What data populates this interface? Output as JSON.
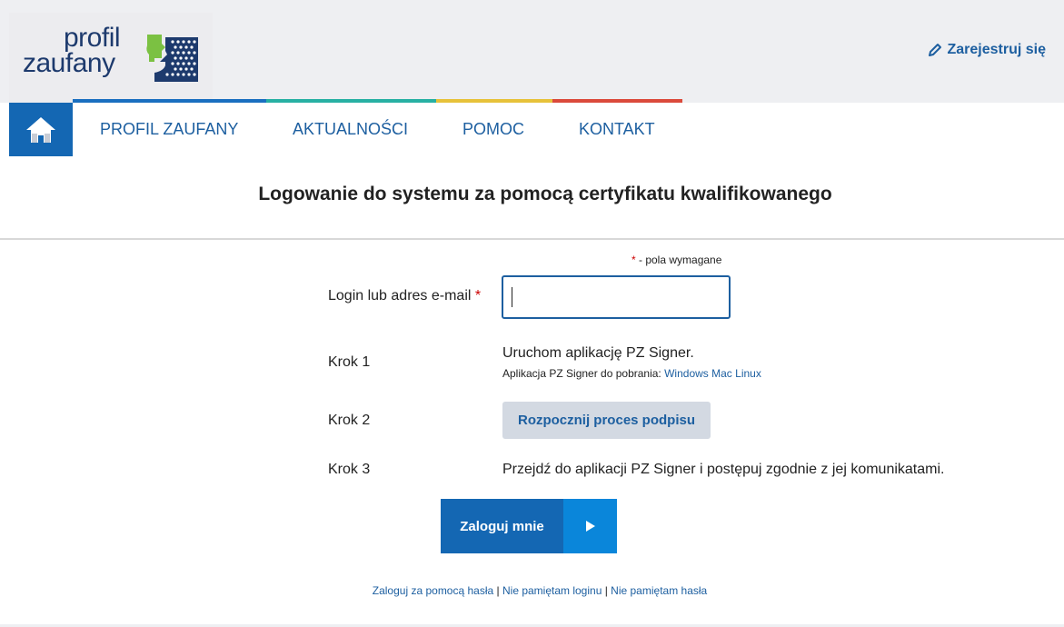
{
  "header": {
    "logo_line1": "profil",
    "logo_line2": "zaufany",
    "register_label": "Zarejestruj się"
  },
  "nav": {
    "items": [
      {
        "label": "PROFIL ZAUFANY"
      },
      {
        "label": "AKTUALNOŚCI"
      },
      {
        "label": "POMOC"
      },
      {
        "label": "KONTAKT"
      }
    ]
  },
  "colors": {
    "stripe_blue": "#1a6fc0",
    "stripe_teal": "#27b0a3",
    "stripe_yellow": "#e7c23a",
    "stripe_red": "#db4a3b",
    "accent": "#1467b3"
  },
  "page": {
    "title": "Logowanie do systemu za pomocą certyfikatu kwalifikowanego",
    "required_star": "*",
    "required_note": " - pola wymagane"
  },
  "form": {
    "login_label": "Login lub adres e-mail",
    "login_star": "*",
    "login_value": "",
    "step1_label": "Krok 1",
    "step1_text": "Uruchom aplikację PZ Signer.",
    "step1_sub": "Aplikacja PZ Signer do pobrania: ",
    "download_windows": "Windows",
    "download_mac": "Mac",
    "download_linux": "Linux",
    "step2_label": "Krok 2",
    "step2_button": "Rozpocznij proces podpisu",
    "step3_label": "Krok 3",
    "step3_text": "Przejdź do aplikacji PZ Signer i postępuj zgodnie z jej komunikatami.",
    "login_button": "Zaloguj mnie"
  },
  "footer_links": {
    "password_login": "Zaloguj za pomocą hasła",
    "sep": " | ",
    "forgot_login": "Nie pamiętam loginu",
    "forgot_password": "Nie pamiętam hasła"
  }
}
